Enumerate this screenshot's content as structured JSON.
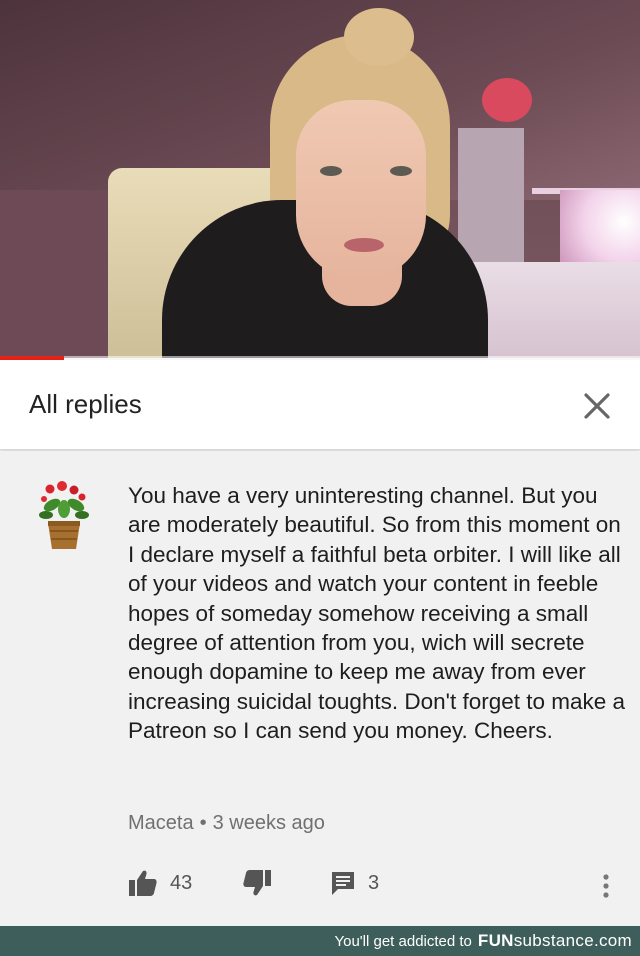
{
  "video": {
    "progress_fraction": 0.1
  },
  "header": {
    "title": "All replies",
    "close_icon": "close-icon"
  },
  "comment": {
    "avatar_icon": "flower-pot-icon",
    "text": "You have a very uninteresting channel. But you are moderately beautiful. So from this moment on I declare myself a faithful beta orbiter. I will like all of your videos and watch your content in feeble hopes of someday somehow receiving a small degree of attention from you, wich will secrete enough dopamine to keep me away from ever increasing suicidal toughts. Don't forget to make a Patreon so I can send you money. Cheers.",
    "author": "Maceta",
    "separator": "•",
    "time": "3 weeks ago",
    "likes": "43",
    "replies": "3"
  },
  "footer": {
    "tagline": "You'll get addicted to",
    "brand_bold": "FUN",
    "brand_rest": "substance.com"
  },
  "colors": {
    "progress": "#e62117",
    "footer_bg": "#3d5e5a",
    "meta_text": "#707070"
  }
}
